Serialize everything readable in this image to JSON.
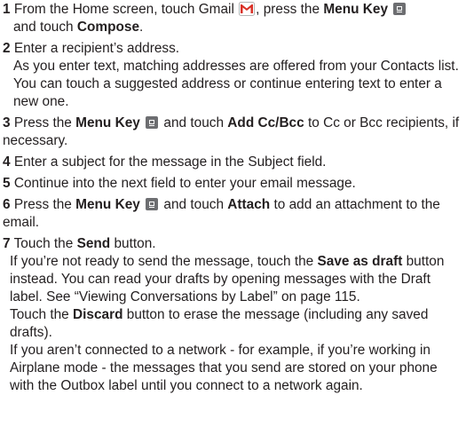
{
  "steps": [
    {
      "num": "1",
      "parts": [
        "From the Home screen, touch Gmail ",
        ", press the ",
        "Menu Key",
        " and touch ",
        "Compose",
        "."
      ]
    },
    {
      "num": "2",
      "text": "Enter a recipient’s address.",
      "detail": "As you enter text, matching addresses are offered from your Contacts list. You can touch a suggested address or continue entering text to enter a new one."
    },
    {
      "num": "3",
      "parts": [
        "Press the ",
        "Menu Key",
        " and touch ",
        "Add Cc/Bcc",
        " to Cc or Bcc recipients, if necessary."
      ]
    },
    {
      "num": "4",
      "text": "Enter a subject for the message in the Subject field."
    },
    {
      "num": "5",
      "text": "Continue into the next field to enter your email message."
    },
    {
      "num": "6",
      "parts": [
        "Press the ",
        "Menu Key",
        " and touch ",
        "Attach",
        " to add an attachment to the email."
      ]
    },
    {
      "num": "7",
      "parts": [
        "Touch the ",
        "Send",
        " button."
      ],
      "notes": [
        [
          "If you’re not ready to send the message, touch the ",
          "Save as draft",
          " button instead. You can read your drafts by opening messages with the Draft label. See “Viewing Conversations by Label” on page 115."
        ],
        [
          "Touch the ",
          "Discard",
          " button to erase the message (including any saved drafts)."
        ],
        [
          "If you aren’t connected to a network - for example, if you’re working in Airplane mode - the messages that you send are stored on your phone with the Outbox label until you connect to a network again."
        ]
      ]
    }
  ]
}
